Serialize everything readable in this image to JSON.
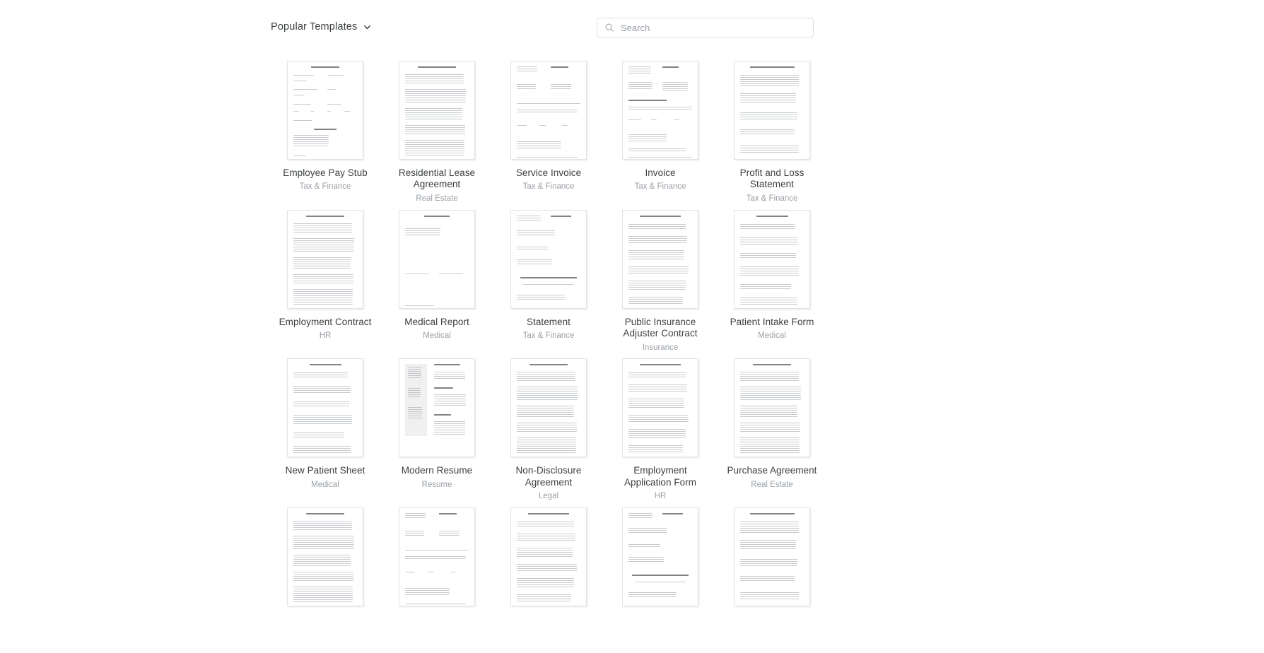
{
  "header": {
    "dropdown_label": "Popular Templates",
    "dropdown_icon": "chevron-down-icon",
    "search": {
      "icon": "search-icon",
      "placeholder": "Search",
      "value": ""
    }
  },
  "colors": {
    "text_primary": "#3c4043",
    "text_muted": "#9aa0a6",
    "border": "#e0e0e0",
    "background": "#ffffff"
  },
  "grid": {
    "columns": 5,
    "rows": [
      {
        "items": [
          {
            "title": "Employee Pay Stub",
            "category": "Tax & Finance",
            "thumb": "payslip"
          },
          {
            "title": "Residential Lease Agreement",
            "category": "Real Estate",
            "thumb": "dense-legal"
          },
          {
            "title": "Service Invoice",
            "category": "Tax & Finance",
            "thumb": "invoice"
          },
          {
            "title": "Invoice",
            "category": "Tax & Finance",
            "thumb": "invoice2"
          },
          {
            "title": "Profit and Loss Statement",
            "category": "Tax & Finance",
            "thumb": "report"
          }
        ]
      },
      {
        "items": [
          {
            "title": "Employment Contract",
            "category": "HR",
            "thumb": "dense-legal"
          },
          {
            "title": "Medical Report",
            "category": "Medical",
            "thumb": "sparse-form"
          },
          {
            "title": "Statement",
            "category": "Tax & Finance",
            "thumb": "statement"
          },
          {
            "title": "Public Insurance Adjuster Contract",
            "category": "Insurance",
            "thumb": "contract"
          },
          {
            "title": "Patient Intake Form",
            "category": "Medical",
            "thumb": "intake"
          }
        ]
      },
      {
        "items": [
          {
            "title": "New Patient Sheet",
            "category": "Medical",
            "thumb": "intake"
          },
          {
            "title": "Modern Resume",
            "category": "Resume",
            "thumb": "resume"
          },
          {
            "title": "Non-Disclosure Agreement",
            "category": "Legal",
            "thumb": "dense-legal"
          },
          {
            "title": "Employment Application Form",
            "category": "HR",
            "thumb": "contract"
          },
          {
            "title": "Purchase Agreement",
            "category": "Real Estate",
            "thumb": "dense-legal"
          }
        ]
      },
      {
        "partial": true,
        "items": [
          {
            "title": "",
            "category": "",
            "thumb": "dense-legal"
          },
          {
            "title": "",
            "category": "",
            "thumb": "invoice"
          },
          {
            "title": "",
            "category": "",
            "thumb": "contract"
          },
          {
            "title": "",
            "category": "",
            "thumb": "statement"
          },
          {
            "title": "",
            "category": "",
            "thumb": "report"
          }
        ]
      }
    ]
  }
}
